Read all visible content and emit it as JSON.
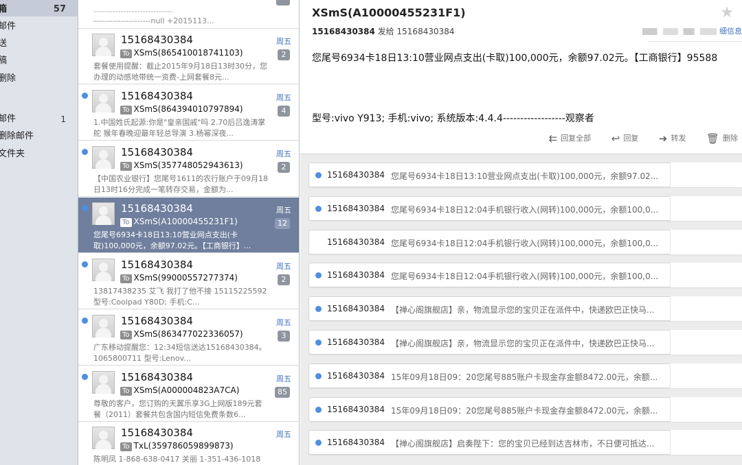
{
  "sidebar": {
    "items": [
      {
        "label": "箱",
        "count": "57",
        "bold": true
      },
      {
        "label": "邮件",
        "count": ""
      },
      {
        "label": "送",
        "count": ""
      },
      {
        "label": "稿",
        "count": ""
      },
      {
        "label": "删除",
        "count": ""
      },
      {
        "label": "邮件",
        "count": "1"
      },
      {
        "label": "删除邮件",
        "count": ""
      },
      {
        "label": "文件夹",
        "count": ""
      }
    ]
  },
  "list": {
    "top_partial": {
      "line1": "-----------------------------",
      "line2": "---------------------null +2015113..."
    },
    "messages": [
      {
        "from": "15168430384",
        "day": "周五",
        "to": "XSmS(865410018741103)",
        "badge": "2",
        "preview": "套餐使用提醒：截止2015年9月18日13时30分，您办理的动感地带统一资费-上网套餐8元...",
        "unread": false,
        "selected": false
      },
      {
        "from": "15168430384",
        "day": "周五",
        "to": "XSmS(864394010797894)",
        "badge": "4",
        "preview": "1.中国姓氏起源:你是\"皇亲国戚\"吗 2.70后吕逸涛掌舵 猴年春晚迎最年轻总导演 3.杨幂深夜...",
        "unread": true,
        "selected": false
      },
      {
        "from": "15168430384",
        "day": "周五",
        "to": "XSmS(357748052943613)",
        "badge": "2",
        "preview": "【中国农业银行】您尾号1611的农行账户于09月18日13时16分完成一笔转存交易，金额为...",
        "unread": true,
        "selected": false
      },
      {
        "from": "15168430384",
        "day": "周五",
        "to": "XSmS(A10000455231F1)",
        "badge": "12",
        "preview": "您尾号6934卡18日13:10营业网点支出(卡取)100,000元，余额97.02元。【工商银行】...",
        "unread": true,
        "selected": true
      },
      {
        "from": "15168430384",
        "day": "周五",
        "to": "XSmS(99000557277374)",
        "badge": "2",
        "preview": "13817438235 艾飞 我打了他不接 15115225592 型号:Coolpad Y80D; 手机:C...",
        "unread": true,
        "selected": false
      },
      {
        "from": "15168430384",
        "day": "周五",
        "to": "XSmS(863477022336057)",
        "badge": "3",
        "preview": "广东移动提醒您：12:34短信送达15168430384。1065800711 型号:Lenov...",
        "unread": true,
        "selected": false
      },
      {
        "from": "15168430384",
        "day": "周五",
        "to": "XSmS(A000004823A7CA)",
        "badge": "85",
        "preview": "尊敬的客户，您订购的天翼乐享3G上网版189元套餐（2011）套餐共包含国内短信免费条数6...",
        "unread": true,
        "selected": false
      },
      {
        "from": "15168430384",
        "day": "周五",
        "to": "TxL(359786059899873)",
        "badge": "",
        "preview": "陈明凤 1-868-638-0417 关丽 1-351-436-1018",
        "unread": false,
        "selected": false
      }
    ]
  },
  "reader": {
    "subject": "XSmS(A10000455231F1)",
    "sender": "15168430384",
    "sent_to_label": "发给",
    "recipient": "15168430384",
    "details_label": "细信息",
    "body_line1": "您尾号6934卡18日13:10营业网点支出(卡取)100,000元，余额97.02元。【工商银行】95588",
    "body_line2": "型号:vivo Y913; 手机:vivo; 系统版本:4.4.4------------------观察者",
    "actions": {
      "reply_all": "回复全部",
      "reply": "回复",
      "forward": "转发",
      "delete": "删除"
    }
  },
  "thread": [
    {
      "from": "15168430384",
      "preview": "您尾号6934卡18日13:10营业网点支出(卡取)100,000元，余额97.02...",
      "unread": true
    },
    {
      "from": "15168430384",
      "preview": "您尾号6934卡18日12:04手机银行收入(网转)100,000元，余额100,0...",
      "unread": true
    },
    {
      "from": "15168430384",
      "preview": "您尾号6934卡18日12:04手机银行收入(网转)100,000元，余额100,0...",
      "unread": false
    },
    {
      "from": "15168430384",
      "preview": "您尾号6934卡18日12:04手机银行收入(网转)100,000元，余额100,0...",
      "unread": true
    },
    {
      "from": "15168430384",
      "preview": "【禅心阁旗舰店】亲，物流显示您的宝贝正在派件中，快递欧巴正快马...",
      "unread": true
    },
    {
      "from": "15168430384",
      "preview": "【禅心阁旗舰店】亲，物流显示您的宝贝正在派件中，快递欧巴正快马...",
      "unread": true
    },
    {
      "from": "15168430384",
      "preview": "15年09月18日09：20您尾号885账户卡现金存金额8472.00元，余额...",
      "unread": true
    },
    {
      "from": "15168430384",
      "preview": "15年09月18日09：20您尾号885账户卡现金存金额8472.00元，余额...",
      "unread": true
    },
    {
      "from": "15168430384",
      "preview": "【禅心阁旗舰店】启奏陛下：您的宝贝已经到达吉林市，不日便可抵达...",
      "unread": true
    }
  ]
}
